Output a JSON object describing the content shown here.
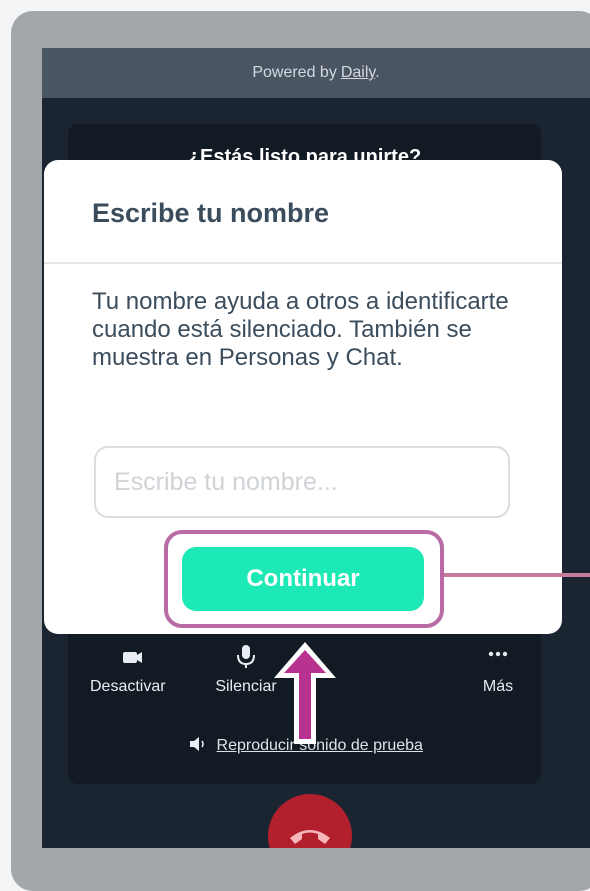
{
  "powered": {
    "prefix": "Powered by",
    "link": "Daily",
    "suffix": "."
  },
  "prejoin": {
    "title": "¿Estás listo para unirte?"
  },
  "dialog": {
    "title": "Escribe tu nombre",
    "description": "Tu nombre ayuda a otros a identificarte cuando está silenciado. También se muestra en Personas y Chat.",
    "input_placeholder": "Escribe tu nombre...",
    "input_value": "",
    "continue_label": "Continuar"
  },
  "controls": {
    "camera_label": "Desactivar",
    "mic_label": "Silenciar",
    "more_label": "Más",
    "test_sound_label": "Reproducir sonido de prueba"
  },
  "icons": {
    "camera": "video-camera-icon",
    "mic": "microphone-icon",
    "more": "more-dots-icon",
    "speaker": "speaker-icon",
    "end_call": "phone-hangup-icon"
  },
  "colors": {
    "accent": "#1de9b6",
    "highlight": "#b86aa4",
    "end_call": "#b21f2d",
    "screen_bg": "#1b2532"
  }
}
